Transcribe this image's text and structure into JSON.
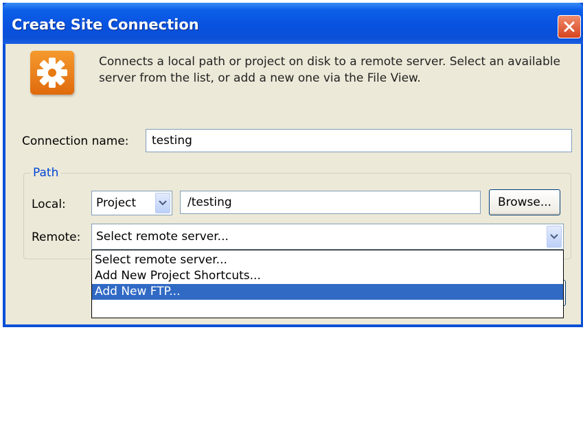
{
  "window": {
    "title": "Create Site Connection",
    "close_icon": "close-icon"
  },
  "header": {
    "icon": "gear-icon",
    "description": "Connects a local path or project on disk to a remote server. Select an available server from the list, or add a new one via the File View."
  },
  "connection": {
    "label": "Connection name:",
    "value": "testing"
  },
  "path": {
    "legend": "Path",
    "local": {
      "label": "Local:",
      "type_value": "Project",
      "path_value": "/testing",
      "browse_label": "Browse..."
    },
    "remote": {
      "label": "Remote:",
      "value": "Select remote server...",
      "options": [
        {
          "label": "Select remote server..."
        },
        {
          "label": "Add New Project Shortcuts..."
        },
        {
          "label": "Add New FTP..."
        }
      ],
      "highlighted_option": "Add New FTP..."
    }
  },
  "colors": {
    "title_bar": "#0a50d8",
    "close_button": "#d6431e",
    "selection": "#316ac5",
    "group_legend": "#0046d5",
    "dialog_bg": "#ece9d8"
  }
}
